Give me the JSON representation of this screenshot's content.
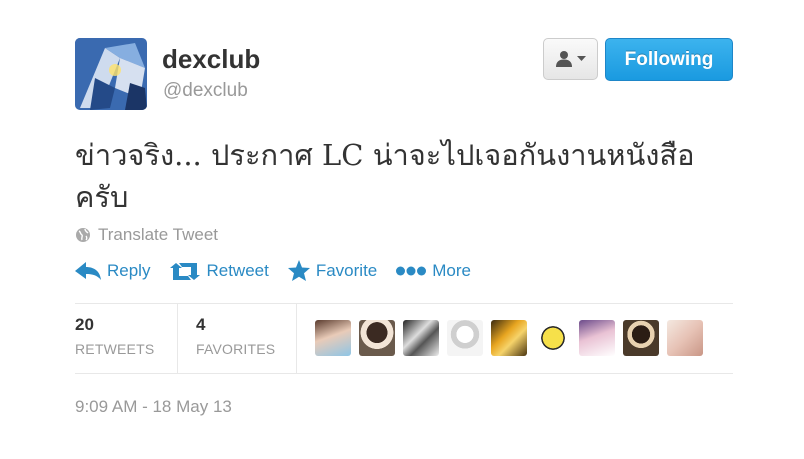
{
  "profile": {
    "display_name": "dexclub",
    "screen_name": "@dexclub"
  },
  "follow_button": {
    "label": "Following"
  },
  "tweet": {
    "text": "ข่าวจริง... ประกาศ LC น่าจะไปเจอกันงานหนังสือครับ"
  },
  "translate": {
    "label": "Translate Tweet"
  },
  "actions": {
    "reply": "Reply",
    "retweet": "Retweet",
    "favorite": "Favorite",
    "more": "More"
  },
  "stats": {
    "retweets": {
      "count": "20",
      "label": "RETWEETS"
    },
    "favorites": {
      "count": "4",
      "label": "FAVORITES"
    }
  },
  "timestamp": "9:09 AM - 18 May 13",
  "colors": {
    "link": "#2a8ac4",
    "follow_button": "#1a9ae0",
    "muted_text": "#999999"
  }
}
